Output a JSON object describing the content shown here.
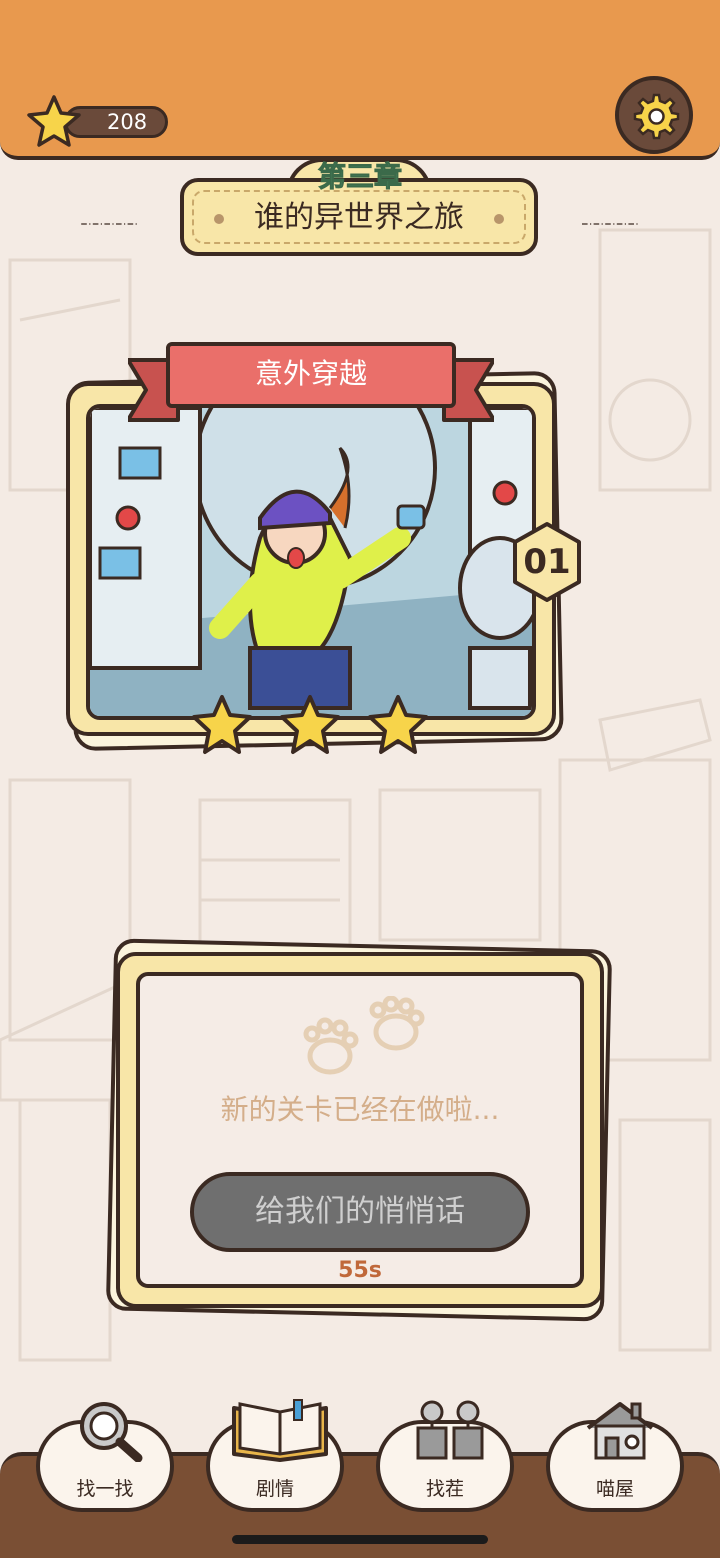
{
  "header": {
    "star_count": "208"
  },
  "chapter": {
    "number": "第三章",
    "title": "谁的异世界之旅"
  },
  "level": {
    "name": "意外穿越",
    "number": "01",
    "stars_earned": 3,
    "stars_total": 3
  },
  "coming_soon": {
    "message": "新的关卡已经在做啦...",
    "button_label": "给我们的悄悄话",
    "countdown": "55s"
  },
  "nav": {
    "items": [
      {
        "label": "找一找",
        "icon": "magnifier-icon"
      },
      {
        "label": "剧情",
        "icon": "book-icon"
      },
      {
        "label": "找茬",
        "icon": "plants-icon"
      },
      {
        "label": "喵屋",
        "icon": "house-icon"
      }
    ]
  },
  "colors": {
    "top_bar": "#e8994e",
    "outline": "#3b2a22",
    "card": "#f8e6a8",
    "ribbon": "#ea6f6a",
    "star": "#f7d44a",
    "chapter_text": "#5fb07a",
    "button_disabled": "#6f6f6f",
    "countdown": "#c0683a",
    "bottom_bar": "#7a4f34"
  }
}
